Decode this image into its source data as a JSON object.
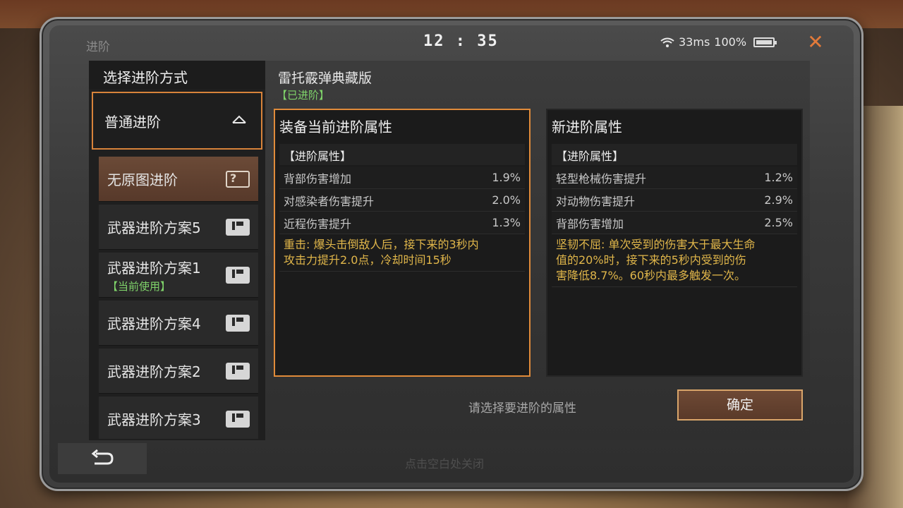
{
  "window": {
    "title": "进阶",
    "time": "12 : 35",
    "ping": "33ms",
    "battery": "100%"
  },
  "left": {
    "header": "选择进阶方式",
    "mode": "普通进阶",
    "plans": [
      {
        "name": "无原图进阶",
        "sub": "",
        "active": true,
        "icon": "question-doc-icon"
      },
      {
        "name": "武器进阶方案5",
        "sub": "",
        "active": false,
        "icon": "doc-icon"
      },
      {
        "name": "武器进阶方案1",
        "sub": "【当前使用】",
        "active": false,
        "icon": "doc-icon"
      },
      {
        "name": "武器进阶方案4",
        "sub": "",
        "active": false,
        "icon": "doc-icon"
      },
      {
        "name": "武器进阶方案2",
        "sub": "",
        "active": false,
        "icon": "doc-icon"
      },
      {
        "name": "武器进阶方案3",
        "sub": "",
        "active": false,
        "icon": "doc-icon"
      }
    ]
  },
  "weapon": {
    "name": "雷托霰弹典藏版",
    "status": "【已进阶】"
  },
  "current_attrs": {
    "title": "装备当前进阶属性",
    "section": "【进阶属性】",
    "rows": [
      {
        "label": "背部伤害增加",
        "value": "1.9%"
      },
      {
        "label": "对感染者伤害提升",
        "value": "2.0%"
      },
      {
        "label": "近程伤害提升",
        "value": "1.3%"
      }
    ],
    "desc_lines": [
      "重击: 爆头击倒敌人后，接下来的3秒内",
      "攻击力提升2.0点，冷却时间15秒"
    ]
  },
  "new_attrs": {
    "title": "新进阶属性",
    "section": "【进阶属性】",
    "rows": [
      {
        "label": "轻型枪械伤害提升",
        "value": "1.2%"
      },
      {
        "label": "对动物伤害提升",
        "value": "2.9%"
      },
      {
        "label": "背部伤害增加",
        "value": "2.5%"
      }
    ],
    "desc_lines": [
      "坚韧不屈: 单次受到的伤害大于最大生命",
      "值的20%时，接下来的5秒内受到的伤",
      "害降低8.7%。60秒内最多触发一次。"
    ]
  },
  "hint": "请选择要进阶的属性",
  "confirm": "确定",
  "bottom_hint": "点击空白处关闭",
  "colors": {
    "accent": "#e08b3a",
    "green": "#7fd36a",
    "gold": "#e0b64a"
  }
}
